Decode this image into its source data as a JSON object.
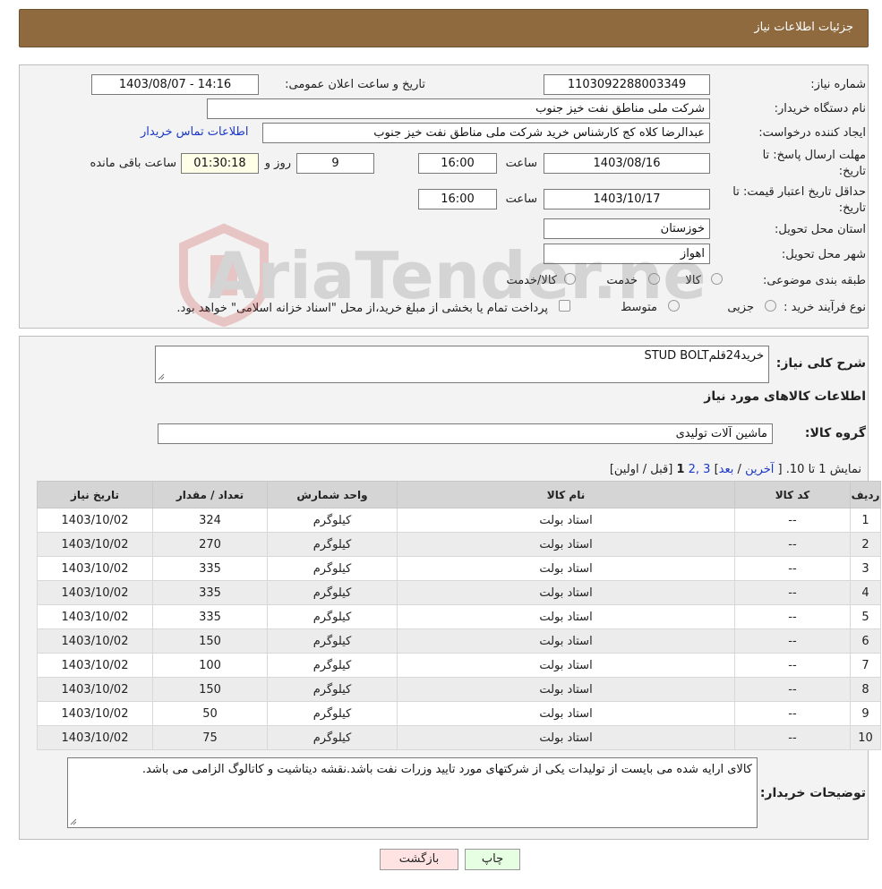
{
  "header": {
    "title": "جزئیات اطلاعات نیاز"
  },
  "form": {
    "need_number_label": "شماره نیاز:",
    "need_number": "1103092288003349",
    "announce_label": "تاریخ و ساعت اعلان عمومی:",
    "announce_value": "1403/08/07 - 14:16",
    "buyer_org_label": "نام دستگاه خریدار:",
    "buyer_org": "شرکت ملی مناطق نفت خیز جنوب",
    "creator_label": "ایجاد کننده درخواست:",
    "creator": "عبدالرضا کلاه کج  کارشناس خرید شرکت ملی مناطق نفت خیز جنوب",
    "contact_link": "اطلاعات تماس خریدار",
    "deadline_label": "مهلت ارسال پاسخ: تا تاریخ:",
    "deadline_date": "1403/08/16",
    "time_label": "ساعت",
    "deadline_time": "16:00",
    "days_value": "9",
    "days_label": "روز و",
    "remaining_time": "01:30:18",
    "remaining_label": "ساعت باقی مانده",
    "validity_label": "حداقل تاریخ اعتبار قیمت: تا تاریخ:",
    "validity_date": "1403/10/17",
    "validity_time": "16:00",
    "province_label": "استان محل تحویل:",
    "province": "خوزستان",
    "city_label": "شهر محل تحویل:",
    "city": "اهواز",
    "category_label": "طبقه بندی موضوعی:",
    "category_options": [
      "کالا",
      "خدمت",
      "کالا/خدمت"
    ],
    "process_label": "نوع فرآیند خرید :",
    "process_options": [
      "جزیی",
      "متوسط"
    ],
    "process_note": "پرداخت تمام یا بخشی از مبلغ خرید،از محل \"اسناد خزانه اسلامی\" خواهد بود."
  },
  "watermark": {
    "text": "AriaTender.neT"
  },
  "details": {
    "summary_label": "شرح کلی نیاز:",
    "summary": "خرید24قلمSTUD    BOLT",
    "goods_heading": "اطلاعات کالاهای مورد نیاز",
    "group_label": "گروه کالا:",
    "group": "ماشین آلات تولیدی"
  },
  "pager": {
    "text_prefix": "نمایش 1 تا 10.",
    "open": "[",
    "last": "آخرین",
    "sep1": "/",
    "next": "بعد",
    "close": "]",
    "pages_link": "3 ,2",
    "current": "1",
    "prev_first": "[قبل / اولین]"
  },
  "table": {
    "headers": [
      "ردیف",
      "کد کالا",
      "نام کالا",
      "واحد شمارش",
      "تعداد / مقدار",
      "تاریخ نیاز"
    ],
    "rows": [
      [
        "1",
        "--",
        "استاد بولت",
        "کیلوگرم",
        "324",
        "1403/10/02"
      ],
      [
        "2",
        "--",
        "استاد بولت",
        "کیلوگرم",
        "270",
        "1403/10/02"
      ],
      [
        "3",
        "--",
        "استاد بولت",
        "کیلوگرم",
        "335",
        "1403/10/02"
      ],
      [
        "4",
        "--",
        "استاد بولت",
        "کیلوگرم",
        "335",
        "1403/10/02"
      ],
      [
        "5",
        "--",
        "استاد بولت",
        "کیلوگرم",
        "335",
        "1403/10/02"
      ],
      [
        "6",
        "--",
        "استاد بولت",
        "کیلوگرم",
        "150",
        "1403/10/02"
      ],
      [
        "7",
        "--",
        "استاد بولت",
        "کیلوگرم",
        "100",
        "1403/10/02"
      ],
      [
        "8",
        "--",
        "استاد بولت",
        "کیلوگرم",
        "150",
        "1403/10/02"
      ],
      [
        "9",
        "--",
        "استاد بولت",
        "کیلوگرم",
        "50",
        "1403/10/02"
      ],
      [
        "10",
        "--",
        "استاد بولت",
        "کیلوگرم",
        "75",
        "1403/10/02"
      ]
    ]
  },
  "buyer_notes": {
    "label": "توضیحات خریدار:",
    "text": "کالای ارایه شده می بایست از تولیدات یکی از شرکتهای مورد تایید وزرات نفت باشد.نقشه دیتاشیت و کاتالوگ الزامی می باشد."
  },
  "buttons": {
    "back": "بازگشت",
    "print": "چاپ"
  },
  "colors": {
    "header": "#8e6a3e",
    "link": "#1a37c8",
    "panel": "#f3f3f3"
  }
}
